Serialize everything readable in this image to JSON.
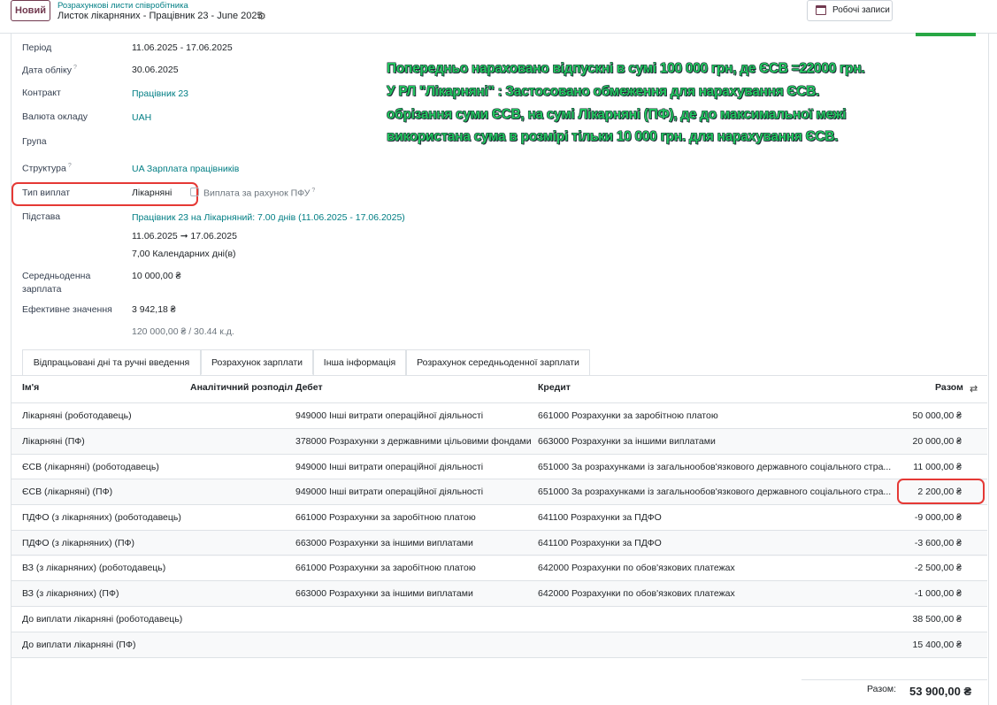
{
  "header": {
    "new_label": "Новий",
    "breadcrumb": "Розрахункові листи співробітника",
    "subtitle": "Листок лікарняних - Працівник 23 - June 2025",
    "work_entries_label": "Робочі записи"
  },
  "fields": {
    "period_label": "Період",
    "period_value": "11.06.2025 - 17.06.2025",
    "accounting_date_label": "Дата обліку",
    "accounting_date_value": "30.06.2025",
    "contract_label": "Контракт",
    "contract_value": "Працівник 23",
    "currency_label": "Валюта окладу",
    "currency_value": "UAH",
    "group_label": "Група",
    "structure_label": "Структура",
    "structure_value": "UA Зарплата працівників",
    "payment_type_label": "Тип виплат",
    "payment_type_value": "Лікарняні",
    "pfu_label": "Виплата за рахунок ПФУ",
    "basis_label": "Підстава",
    "basis_value": "Працівник 23 на Лікарняний: 7.00 днів (11.06.2025 - 17.06.2025)",
    "basis_dates": "11.06.2025 ➞ 17.06.2025",
    "basis_days": "7,00 Календарних дні(в)",
    "avg_salary_label_1": "Середньоденна",
    "avg_salary_label_2": "зарплата",
    "avg_salary_value": "10 000,00 ₴",
    "effective_label": "Ефективне значення",
    "effective_value": "3 942,18 ₴",
    "effective_note": "120 000,00 ₴ / 30.44 к.д."
  },
  "annotation": {
    "line1": "Попередньо нараховано відпускні в сумі 100 000 грн, де ЄСВ =22000 грн.",
    "line2": "У РЛ \"Лікарняні\" : Застосовано обмеження для нарахування ЄСВ.",
    "line3": " обрізання суми ЄСВ, на сумі Лікарняні (ПФ), де до максимальної межі",
    "line4": "використана сума в розмірі тільки 10 000 грн. для нарахування ЄСВ."
  },
  "tabs": [
    {
      "label": "Відпрацьовані дні та ручні введення"
    },
    {
      "label": "Розрахунок зарплати"
    },
    {
      "label": "Інша інформація"
    },
    {
      "label": "Розрахунок середньоденної зарплати"
    }
  ],
  "table": {
    "headers": {
      "name": "Ім'я",
      "analytic": "Аналітичний розподіл",
      "debit": "Дебет",
      "credit": "Кредит",
      "amount": "Разом"
    },
    "rows": [
      {
        "name": "Лікарняні (роботодавець)",
        "debit": "949000 Інші витрати операційної діяльності",
        "credit": "661000 Розрахунки за заробітною платою",
        "amount": "50 000,00 ₴"
      },
      {
        "name": "Лікарняні (ПФ)",
        "debit": "378000 Розрахунки з державними цільовими фондами",
        "credit": "663000 Розрахунки за іншими виплатами",
        "amount": "20 000,00 ₴"
      },
      {
        "name": "ЄСВ (лікарняні) (роботодавець)",
        "debit": "949000 Інші витрати операційної діяльності",
        "credit": "651000 За розрахунками із загальнообов'язкового державного соціального стра...",
        "amount": "11 000,00 ₴"
      },
      {
        "name": "ЄСВ (лікарняні) (ПФ)",
        "debit": "949000 Інші витрати операційної діяльності",
        "credit": "651000 За розрахунками із загальнообов'язкового державного соціального стра...",
        "amount": "2 200,00 ₴"
      },
      {
        "name": "ПДФО (з лікарняних) (роботодавець)",
        "debit": "661000 Розрахунки за заробітною платою",
        "credit": "641100 Розрахунки за ПДФО",
        "amount": "-9 000,00 ₴"
      },
      {
        "name": "ПДФО (з лікарняних) (ПФ)",
        "debit": "663000 Розрахунки за іншими виплатами",
        "credit": "641100 Розрахунки за ПДФО",
        "amount": "-3 600,00 ₴"
      },
      {
        "name": "ВЗ (з лікарняних) (роботодавець)",
        "debit": "661000 Розрахунки за заробітною платою",
        "credit": "642000 Розрахунки по обов'язкових платежах",
        "amount": "-2 500,00 ₴"
      },
      {
        "name": "ВЗ (з лікарняних) (ПФ)",
        "debit": "663000 Розрахунки за іншими виплатами",
        "credit": "642000 Розрахунки по обов'язкових платежах",
        "amount": "-1 000,00 ₴"
      },
      {
        "name": "До виплати лікарняні (роботодавець)",
        "debit": "",
        "credit": "",
        "amount": "38 500,00 ₴"
      },
      {
        "name": "До виплати лікарняні (ПФ)",
        "debit": "",
        "credit": "",
        "amount": "15 400,00 ₴"
      }
    ]
  },
  "total": {
    "label": "Разом:",
    "value": "53 900,00 ₴"
  },
  "colors": {
    "accent": "#71394f",
    "link": "#017e84",
    "highlight": "#e53935",
    "note": "#22c55e"
  }
}
